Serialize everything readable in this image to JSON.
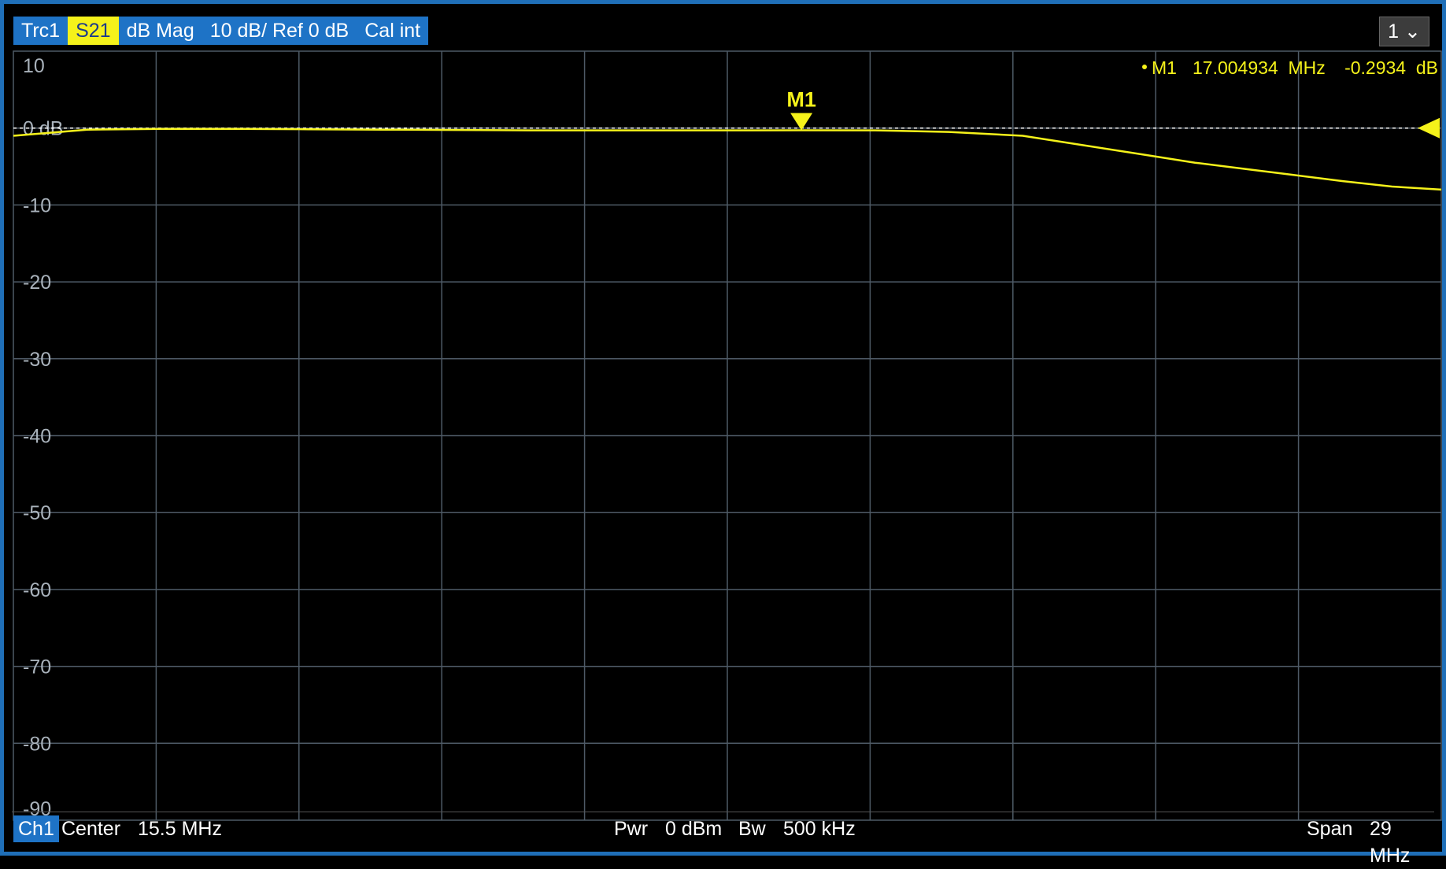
{
  "header": {
    "trace": "Trc1",
    "param": "S21",
    "format": "dB Mag",
    "scale": "10 dB/ Ref 0 dB",
    "cal": "Cal int"
  },
  "channel_selector": "1",
  "footer": {
    "channel": "Ch1",
    "center_label": "Center",
    "center_value": "15.5 MHz",
    "pwr_label": "Pwr",
    "pwr_value": "0 dBm",
    "bw_label": "Bw",
    "bw_value": "500 kHz",
    "span_label": "Span",
    "span_value": "29 MHz"
  },
  "marker": {
    "label": "M1",
    "readout_name": "M1",
    "readout_freq": "17.004934  MHz",
    "readout_value": "-0.2934  dB"
  },
  "colors": {
    "trace": "#f5f21a",
    "accent": "#1e73c6",
    "grid": "#4e5a66",
    "background": "#000000"
  },
  "chart_data": {
    "type": "line",
    "xlim": [
      1.0,
      30.0
    ],
    "ylim": [
      -90,
      10
    ],
    "y_ticks": [
      10,
      0,
      -10,
      -20,
      -30,
      -40,
      -50,
      -60,
      -70,
      -80,
      -90
    ],
    "y_tick_labels": [
      "10",
      "0 dB",
      "-10",
      "-20",
      "-30",
      "-40",
      "-50",
      "-60",
      "-70",
      "-80",
      "-90"
    ],
    "reference_level": 0,
    "grid": true,
    "series": [
      {
        "x": [
          1.0,
          2.5,
          4.0,
          5.5,
          7.0,
          8.5,
          10.0,
          11.5,
          13.0,
          14.5,
          16.0,
          17.0,
          18.5,
          20.0,
          21.5,
          23.0,
          24.0,
          25.0,
          26.0,
          27.0,
          28.0,
          29.0,
          30.0
        ],
        "y": [
          -1.0,
          -0.2,
          -0.1,
          -0.1,
          -0.15,
          -0.2,
          -0.25,
          -0.3,
          -0.3,
          -0.3,
          -0.3,
          -0.29,
          -0.3,
          -0.5,
          -1.0,
          -2.5,
          -3.5,
          -4.5,
          -5.3,
          -6.1,
          -6.9,
          -7.6,
          -8.0
        ]
      }
    ],
    "markers": [
      {
        "name": "M1",
        "x": 17.004934,
        "y": -0.2934
      }
    ]
  }
}
